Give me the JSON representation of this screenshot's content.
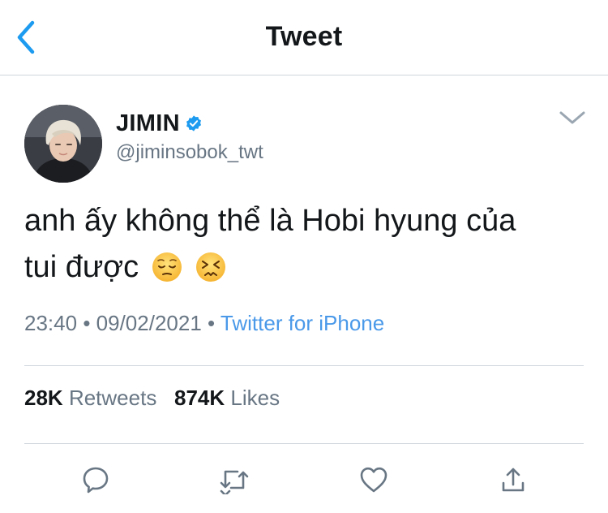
{
  "header": {
    "title": "Tweet",
    "back_icon": "chevron-left-icon",
    "accent_color": "#1da1f2"
  },
  "author": {
    "name": "JIMIN",
    "handle": "@jiminsobok_twt",
    "verified": true
  },
  "tweet": {
    "text_line1": "anh ấy không thể là Hobi hyung của",
    "text_line2": "tui được",
    "emojis": [
      "pensive-face",
      "persevering-face"
    ]
  },
  "meta": {
    "time": "23:40",
    "separator": "•",
    "date": "09/02/2021",
    "source": "Twitter for iPhone"
  },
  "stats": {
    "retweets_count": "28K",
    "retweets_label": "Retweets",
    "likes_count": "874K",
    "likes_label": "Likes"
  },
  "actions": [
    "reply-icon",
    "retweet-icon",
    "like-icon",
    "share-icon"
  ]
}
